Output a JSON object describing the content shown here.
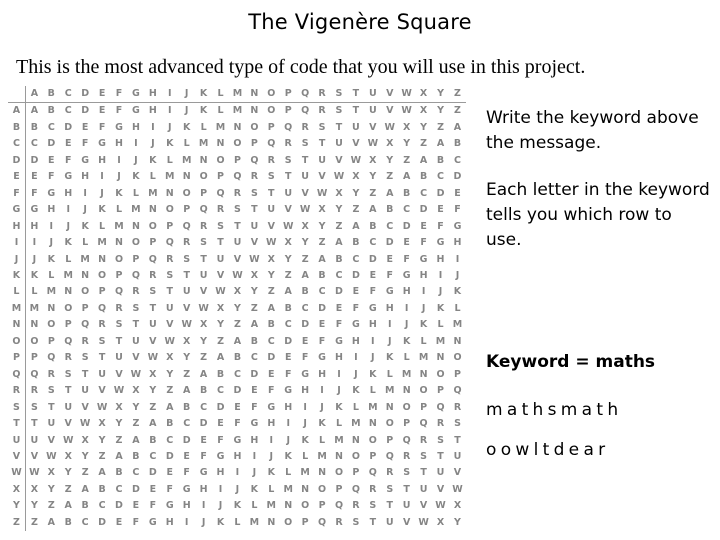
{
  "slide": {
    "title": "The Vigenère Square",
    "subtitle": "This is the most advanced type of code that you will use in this project."
  },
  "vigenere_square": {
    "alphabet": "ABCDEFGHIJKLMNOPQRSTUVWXYZ",
    "corner_label": "",
    "column_headers": [
      "A",
      "B",
      "C",
      "D",
      "E",
      "F",
      "G",
      "H",
      "I",
      "J",
      "K",
      "L",
      "M",
      "N",
      "O",
      "P",
      "Q",
      "R",
      "S",
      "T",
      "U",
      "V",
      "W",
      "X",
      "Y",
      "Z"
    ],
    "row_headers": [
      "A",
      "B",
      "C",
      "D",
      "E",
      "F",
      "G",
      "H",
      "I",
      "J",
      "K",
      "L",
      "M",
      "N",
      "O",
      "P",
      "Q",
      "R",
      "S",
      "T",
      "U",
      "V",
      "W",
      "X",
      "Y",
      "Z"
    ],
    "rows": [
      "ABCDEFGHIJKLMNOPQRSTUVWXYZ",
      "BCDEFGHIJKLMNOPQRSTUVWXYZA",
      "CDEFGHIJKLMNOPQRSTUVWXYZAB",
      "DEFGHIJKLMNOPQRSTUVWXYZABC",
      "EFGHIJKLMNOPQRSTUVWXYZABCD",
      "FGHIJKLMNOPQRSTUVWXYZABCDE",
      "GHIJKLMNOPQRSTUVWXYZABCDEF",
      "HIJKLMNOPQRSTUVWXYZABCDEFG",
      "IJKLMNOPQRSTUVWXYZABCDEFGH",
      "JKLMNOPQRSTUVWXYZABCDEFGHI",
      "KLMNOPQRSTUVWXYZABCDEFGHIJ",
      "LMNOPQRSTUVWXYZABCDEFGHIJK",
      "MNOPQRSTUVWXYZABCDEFGHIJKL",
      "NOPQRSTUVWXYZABCDEFGHIJKLM",
      "OPQRSTUVWXYZABCDEFGHIJKLMN",
      "PQRSTUVWXYZABCDEFGHIJKLMNO",
      "QRSTUVWXYZABCDEFGHIJKLMNOP",
      "RSTUVWXYZABCDEFGHIJKLMNOPQ",
      "STUVWXYZABCDEFGHIJKLMNOPQR",
      "TUVWXYZABCDEFGHIJKLMNOPQRS",
      "UVWXYZABCDEFGHIJKLMNOPQRST",
      "VWXYZABCDEFGHIJKLMNOPQRSTU",
      "WXYZABCDEFGHIJKLMNOPQRSTUV",
      "XYZABCDEFGHIJKLMNOPQRSTUVW",
      "YZABCDEFGHIJKLMNOPQRSTUVWX",
      "ZABCDEFGHIJKLMNOPQRSTUVWXY"
    ]
  },
  "notes": {
    "paragraphs": [
      "Write the keyword above the message.",
      "Each letter in the keyword tells you which row to use."
    ]
  },
  "keyword_example": {
    "label": "Keyword = maths",
    "keyword_line": "mathsmath",
    "plain_line": "oowltdear"
  },
  "colors": {
    "text": "#000000",
    "grid_text": "#7b7b7b",
    "grid_rule": "#9a9a9a",
    "background": "#ffffff"
  }
}
